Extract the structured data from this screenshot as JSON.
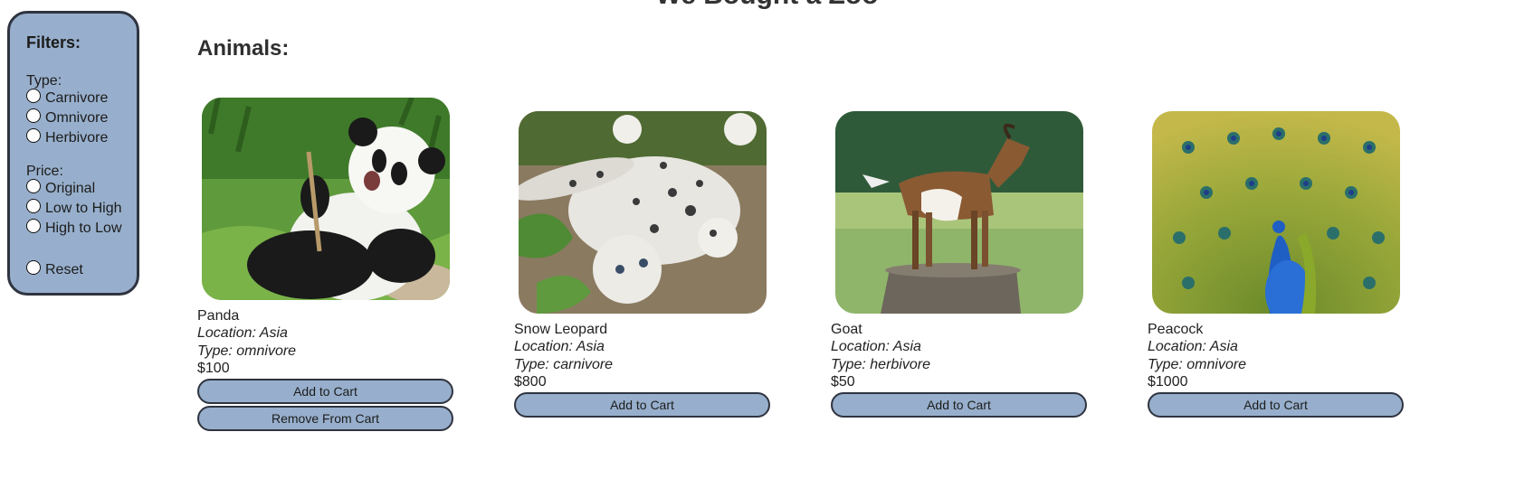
{
  "page": {
    "title": "We Bought a Zoo"
  },
  "filters": {
    "heading": "Filters:",
    "type_label": "Type:",
    "type_options": [
      "Carnivore",
      "Omnivore",
      "Herbivore"
    ],
    "price_label": "Price:",
    "price_options": [
      "Original",
      "Low to High",
      "High to Low"
    ],
    "reset_label": "Reset"
  },
  "main": {
    "heading": "Animals:"
  },
  "animals": [
    {
      "name": "Panda",
      "location": "Location: Asia",
      "type": "Type: omnivore",
      "price": "$100",
      "add_label": "Add to Cart",
      "remove_label": "Remove From Cart"
    },
    {
      "name": "Snow Leopard",
      "location": "Location: Asia",
      "type": "Type: carnivore",
      "price": "$800",
      "add_label": "Add to Cart"
    },
    {
      "name": "Goat",
      "location": "Location: Asia",
      "type": "Type: herbivore",
      "price": "$50",
      "add_label": "Add to Cart"
    },
    {
      "name": "Peacock",
      "location": "Location: Asia",
      "type": "Type: omnivore",
      "price": "$1000",
      "add_label": "Add to Cart"
    }
  ],
  "colors": {
    "panel": "#97afcc",
    "border": "#2f3440"
  }
}
